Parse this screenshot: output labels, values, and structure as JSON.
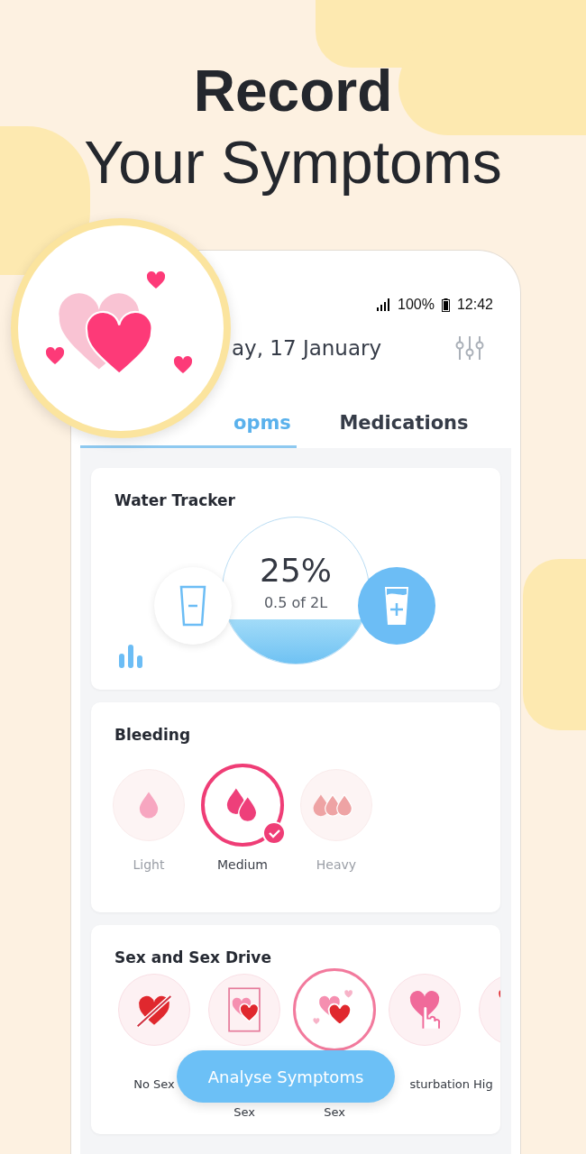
{
  "headline": {
    "title": "Record",
    "subtitle": "Your Symptoms"
  },
  "status_bar": {
    "battery": "100%",
    "time": "12:42"
  },
  "date": "ay, 17 January",
  "tabs": [
    {
      "label": "opms",
      "selected": true
    },
    {
      "label": "Medications",
      "selected": false
    }
  ],
  "water_tracker": {
    "title": "Water Tracker",
    "percent": "25%",
    "amount": "0.5 of 2L"
  },
  "bleeding": {
    "title": "Bleeding",
    "options": [
      {
        "label": "Light",
        "kind": "light",
        "selected": false
      },
      {
        "label": "Medium",
        "kind": "medium",
        "selected": true
      },
      {
        "label": "Heavy",
        "kind": "heavy",
        "selected": false
      }
    ]
  },
  "sex_drive": {
    "title": "Sex and Sex Drive",
    "options": [
      {
        "label": "No Sex",
        "kind": "no-sex",
        "selected": false,
        "wrapped": false
      },
      {
        "label": "Sex",
        "kind": "protected",
        "selected": false,
        "wrapped": true
      },
      {
        "label": "Sex",
        "kind": "unprotected",
        "selected": true,
        "wrapped": true
      },
      {
        "label": "sturbation",
        "kind": "masturbation",
        "selected": false,
        "wrapped": false
      },
      {
        "label": "Hig",
        "kind": "high-drive",
        "selected": false,
        "wrapped": false
      }
    ]
  },
  "action_button": "Analyse Symptoms"
}
